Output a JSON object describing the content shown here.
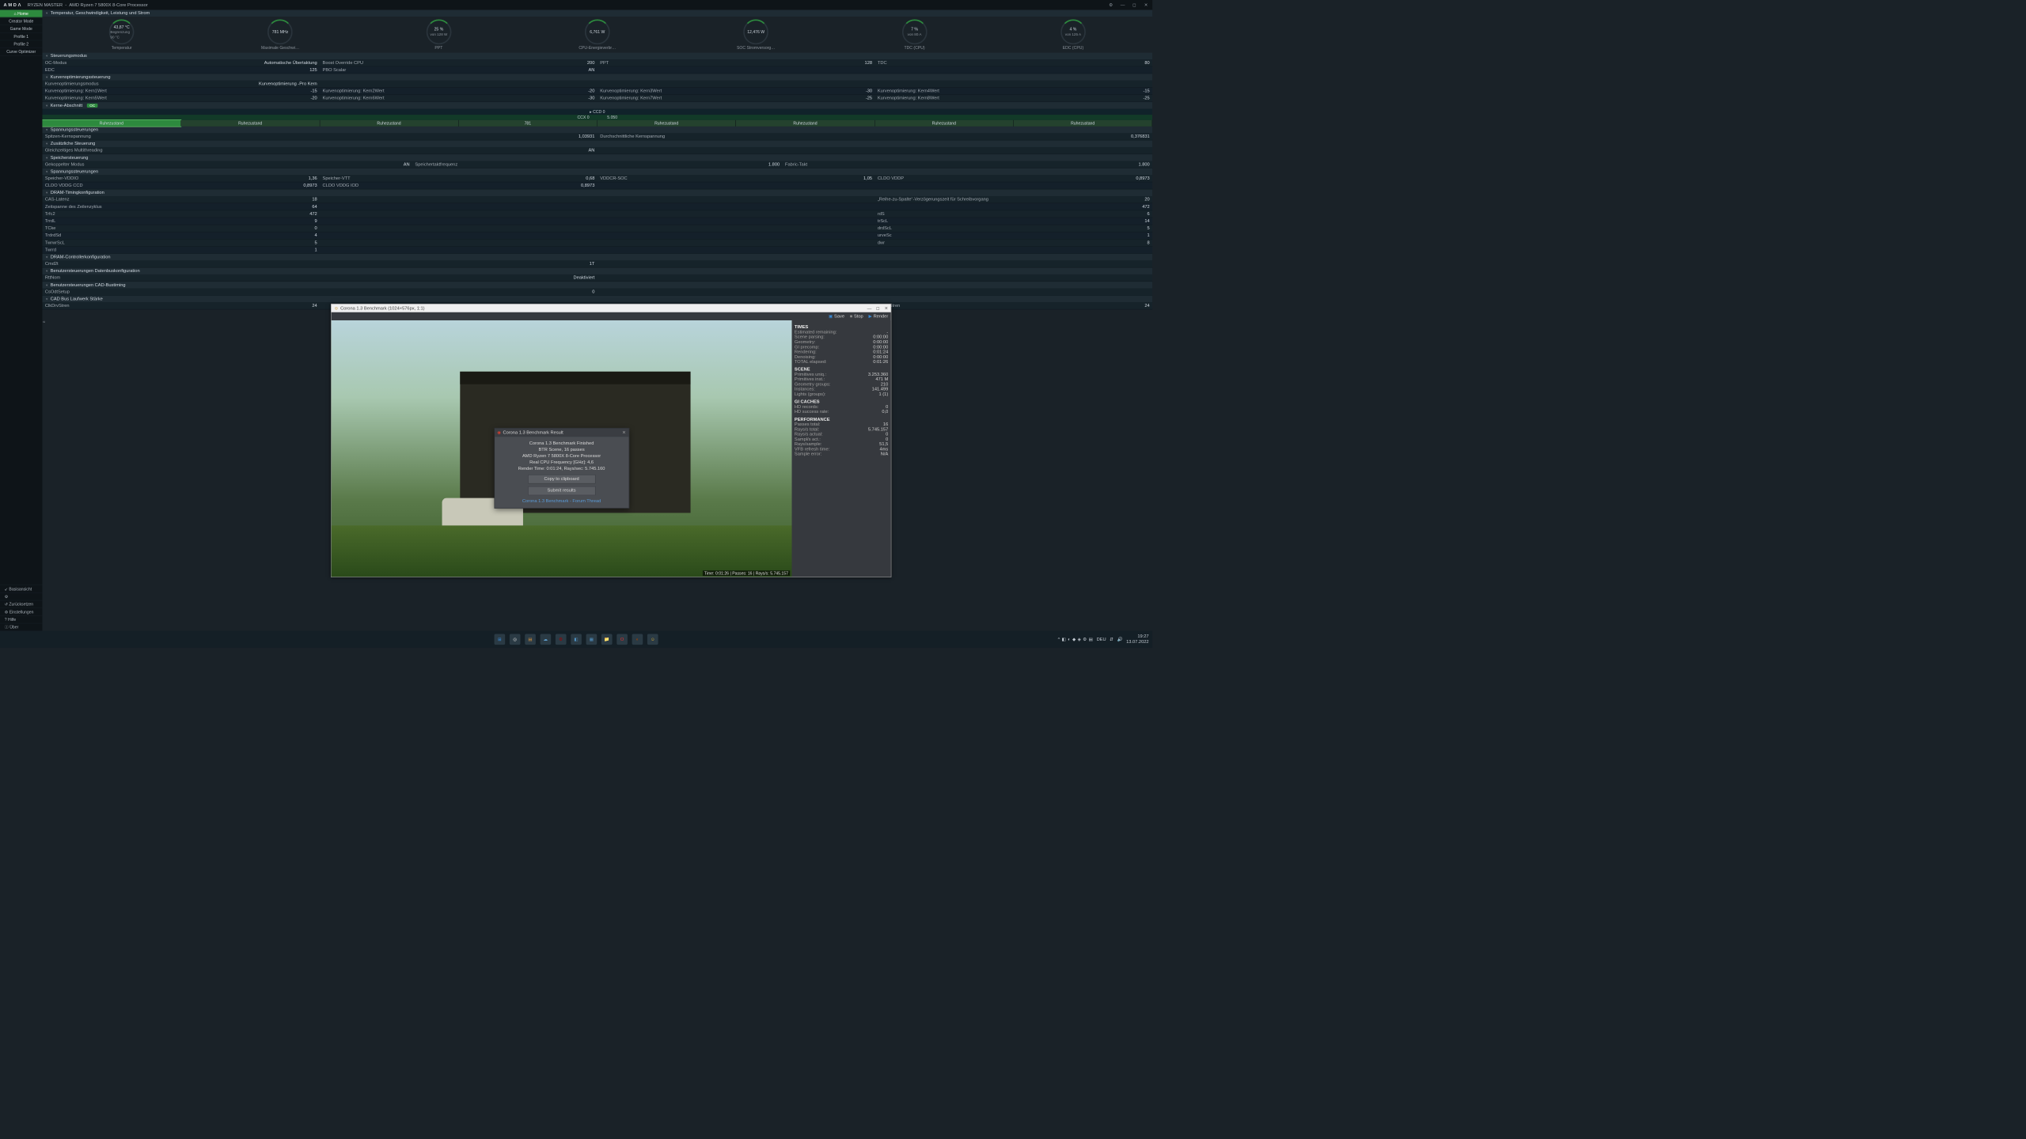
{
  "titlebar": {
    "logo": "AMDΛ",
    "app": "RYZEN MASTER",
    "cpu": "AMD Ryzen 7 5800X 8-Core Processor"
  },
  "sidebar": {
    "items": [
      "Home",
      "Creator Mode",
      "Game Mode",
      "Profile 1",
      "Profile 2",
      "Curve Optimizer"
    ],
    "bottom": [
      "Basisansicht",
      "",
      "Zurücksetzen",
      "Einstellungen",
      "Hilfe",
      "Über"
    ],
    "bottom_icons": [
      "↙",
      "⚙",
      "↺",
      "⚙",
      "?",
      "ⓘ"
    ]
  },
  "sections": {
    "top": "Temperatur, Geschwindigkeit, Leistung und Strom",
    "steuer": "Steuerungsmodus",
    "kurven": "Kurvenoptimierungssteuerung",
    "kerne": "Kerne-Abschnitt",
    "kerne_pill": "OC",
    "spann": "Spannungssteuerungen",
    "zus": "Zusätzliche Steuerung",
    "speicher": "Speichersteuerung",
    "spann2": "Spannungssteuerungen",
    "dramtk": "DRAM-Timingkonfiguration",
    "dramcc": "DRAM-Controllerkonfiguration",
    "bendb": "Benutzersteuerungen Datenbuskonfiguration",
    "bencad": "Benutzersteuerungen CAD-Bustiming",
    "cadbs": "CAD Bus Laufwerk Stärke"
  },
  "gauges": [
    {
      "v1": "43,87 °C",
      "v2": "Begrenzung 90 °C",
      "lbl": "Temperatur"
    },
    {
      "v1": "781  MHz",
      "v2": "",
      "lbl": "Maximale Geschwi…"
    },
    {
      "v1": "25 %",
      "v2": "von 128 W",
      "lbl": "PPT"
    },
    {
      "v1": "6,761 W",
      "v2": "",
      "lbl": "CPU-Energieverbr…"
    },
    {
      "v1": "12,476 W",
      "v2": "",
      "lbl": "SOC Stromversorg…"
    },
    {
      "v1": "7 %",
      "v2": "von 80 A",
      "lbl": "TDC (CPU)"
    },
    {
      "v1": "4 %",
      "v2": "von 125 A",
      "lbl": "EDC (CPU)"
    }
  ],
  "steuer_rows": [
    [
      [
        "OC-Modus",
        "Automatische Übertaktung"
      ],
      [
        "Boost Override CPU",
        "200"
      ],
      [
        "PPT",
        "128"
      ],
      [
        "TDC",
        "80"
      ]
    ],
    [
      [
        "EDC",
        "125"
      ],
      [
        "PBO Scalar",
        "AN"
      ]
    ]
  ],
  "kurven_rows": [
    [
      [
        "Kurvenoptimierungsmodus",
        "Kurvenoptimierung -Pro Kern"
      ]
    ],
    [
      [
        "Kurvenoptimierung: Kern1Wert",
        "-15"
      ],
      [
        "Kurvenoptimierung: Kern2Wert",
        "-20"
      ],
      [
        "Kurvenoptimierung: Kern3Wert",
        "-30"
      ],
      [
        "Kurvenoptimierung: Kern4Wert",
        "-15"
      ]
    ],
    [
      [
        "Kurvenoptimierung: Kern5Wert",
        "-20"
      ],
      [
        "Kurvenoptimierung: Kern6Wert",
        "-30"
      ],
      [
        "Kurvenoptimierung: Kern7Wert",
        "-25"
      ],
      [
        "Kurvenoptimierung: Kern8Wert",
        "-25"
      ]
    ]
  ],
  "ccd": "CCD 0",
  "ccx": {
    "label": "CCX 0",
    "val": "5.050"
  },
  "cores": [
    "Ruhezustand",
    "Ruhezustand",
    "Ruhezustand",
    "781",
    "Ruhezustand",
    "Ruhezustand",
    "Ruhezustand",
    "Ruhezustand"
  ],
  "core_sel": 0,
  "spann_rows": [
    [
      [
        "Spitzen-Kernspannung",
        "1,03931"
      ],
      [
        "Durchschnittliche Kernspannung",
        "0,376831"
      ]
    ]
  ],
  "zus_rows": [
    [
      [
        "Gleichzeitiges Multithreading",
        "AN"
      ]
    ]
  ],
  "speicher_rows": [
    [
      [
        "Gekoppelter Modus",
        "AN"
      ],
      [
        "Speichertaktfrequenz",
        "1.800"
      ],
      [
        "Fabric-Takt",
        "1.800"
      ]
    ]
  ],
  "spann2_rows": [
    [
      [
        "Speicher-VDDIO",
        "1,36"
      ],
      [
        "Speicher-VTT",
        "0,68"
      ],
      [
        "VDDCR-SOC",
        "1,05"
      ],
      [
        "CLDO VDDP",
        "0,8973"
      ]
    ],
    [
      [
        "CLDO VDDG CCD",
        "0,8973"
      ],
      [
        "CLDO VDDG IOD",
        "0,8973"
      ]
    ]
  ],
  "dramtk_rows": [
    [
      [
        "CAS-Latenz",
        "18"
      ],
      [
        "",
        ""
      ],
      [
        "",
        ""
      ],
      [
        "„Reihe-zu-Spalte“-Verzögerungszeit für Schreibvorgang",
        "20"
      ]
    ],
    [
      [
        "Zeitspanne des Zeilenzyklus",
        "64"
      ],
      [
        "",
        ""
      ],
      [
        "",
        ""
      ],
      [
        "",
        "472"
      ]
    ],
    [
      [
        "Trfc2",
        "472"
      ],
      [
        "",
        ""
      ],
      [
        "",
        ""
      ],
      [
        "rdS",
        "6"
      ]
    ],
    [
      [
        "TrrdL",
        "9"
      ],
      [
        "",
        ""
      ],
      [
        "",
        ""
      ],
      [
        "trScL",
        "14"
      ]
    ],
    [
      [
        "TCke",
        "0"
      ],
      [
        "",
        ""
      ],
      [
        "",
        ""
      ],
      [
        "drdScL",
        "5"
      ]
    ],
    [
      [
        "TrdrdSd",
        "4"
      ],
      [
        "",
        ""
      ],
      [
        "",
        ""
      ],
      [
        "urveSc",
        "1"
      ]
    ],
    [
      [
        "TwrwrScL",
        "5"
      ],
      [
        "",
        ""
      ],
      [
        "",
        ""
      ],
      [
        "dwr",
        "8"
      ]
    ],
    [
      [
        "Twrrd",
        "1"
      ]
    ]
  ],
  "dramcc_rows": [
    [
      [
        "Cmd2t",
        "1T"
      ]
    ]
  ],
  "bendb_rows": [
    [
      [
        "RttNom",
        "Deaktiviert"
      ]
    ]
  ],
  "bencad_rows": [
    [
      [
        "CsOdtSetup",
        "0"
      ]
    ]
  ],
  "cadbs_rows": [
    [
      [
        "ClkDrvStren",
        "24"
      ],
      [
        "",
        ""
      ],
      [
        "",
        ""
      ],
      [
        "keDrvStren",
        "24"
      ]
    ]
  ],
  "corona": {
    "title": "Corona 1.3 Benchmark (1024×576px, 1:1)",
    "toolbar": {
      "save": "Save",
      "stop": "Stop",
      "render": "Render"
    },
    "side": {
      "times_h": "TIMES",
      "times": [
        [
          "Estimated remaining:",
          "-"
        ],
        [
          "Scene parsing:",
          "0:00:00"
        ],
        [
          "Geometry:",
          "0:00:00"
        ],
        [
          "GI precomp:",
          "0:00:00"
        ],
        [
          "Rendering:",
          "0:01:24"
        ],
        [
          "Denoising:",
          "0:00:00"
        ],
        [
          "TOTAL elapsed:",
          "0:01:26"
        ]
      ],
      "scene_h": "SCENE",
      "scene": [
        [
          "Primitives uniq.:",
          "3.253.360"
        ],
        [
          "Primitives inst.:",
          "471 M"
        ],
        [
          "Geometry groups:",
          "210"
        ],
        [
          "Instances:",
          "141.499"
        ],
        [
          "Lights (groups):",
          "1 (1)"
        ]
      ],
      "gi_h": "GI CACHES",
      "gi": [
        [
          "HD records:",
          "0"
        ],
        [
          "HD success rate:",
          "0,0"
        ]
      ],
      "perf_h": "PERFORMANCE",
      "perf": [
        [
          "Passes total:",
          "16"
        ],
        [
          "Rays/s total:",
          "5.745.157"
        ],
        [
          "Rays/s actual:",
          "0"
        ],
        [
          "Sampl/s act.:",
          "0"
        ],
        [
          "Rays/sample:",
          "51,5"
        ],
        [
          "VFB refresh time:",
          "4ms"
        ],
        [
          "Sample error:",
          "N/A"
        ]
      ]
    },
    "status": "Time: 0:01:26 | Passes: 16 | Rays/s: 5.745.157",
    "dlg": {
      "title": "Corona 1.3 Benchmark Result",
      "l1": "Corona 1.3 Benchmark Finished",
      "l2": "BTR Scene, 16 passes",
      "l3": "AMD Ryzen 7 5800X 8-Core Processor",
      "l4": "Real CPU Frequency [GHz]: 4,6",
      "l5": "Render Time: 0:01:24, Rays/sec: 5.745.160",
      "b1": "Copy to clipboard",
      "b2": "Submit results",
      "link": "Corona 1.3 Benchmark - Forum Thread"
    }
  },
  "taskbar": {
    "center_colors": [
      "#3a8ad6",
      "#e0e0e0",
      "#d09040",
      "#60a0d0",
      "#a00000",
      "#5090c0",
      "#5090c0",
      "#e0b030",
      "#e03030",
      "#a04000",
      "#e0b030"
    ],
    "tray_icons": [
      "^",
      "◧",
      "◐",
      "◆",
      "◈",
      "⚙",
      "▤"
    ],
    "lang": "DEU",
    "net": "⇵",
    "snd": "🔊",
    "time": "19:27",
    "date": "13.07.2022"
  }
}
